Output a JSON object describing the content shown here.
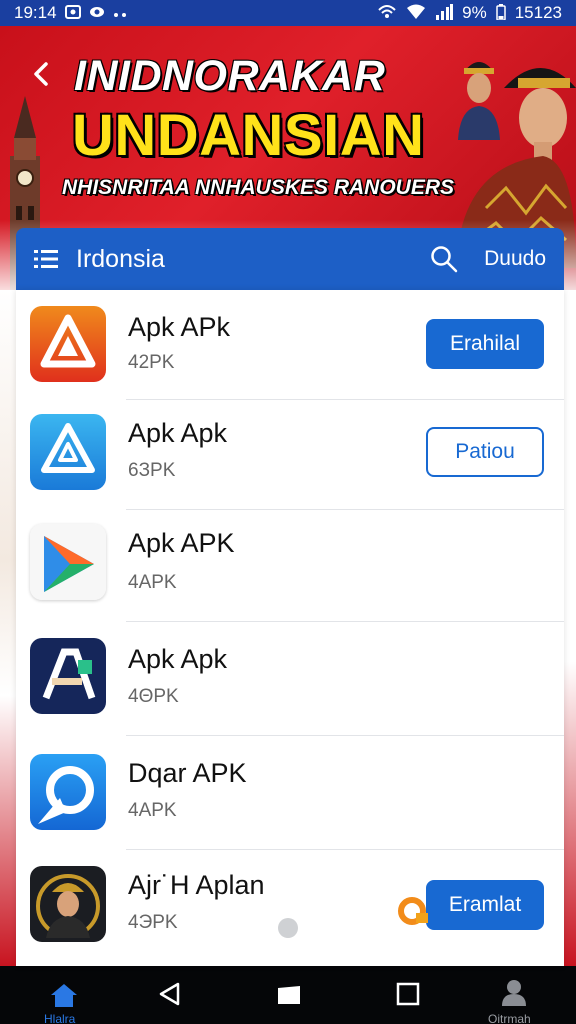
{
  "status_bar": {
    "time": "19:14",
    "battery": "9%",
    "right_time": "15123",
    "icons": [
      "photo-icon",
      "record-icon",
      "more-dots-icon",
      "hotspot-icon",
      "wifi-icon",
      "signal-icon",
      "battery-icon"
    ]
  },
  "banner": {
    "line1": "INIDNORAKAR",
    "line2": "UNDANSIAN",
    "line3": "NHISNRITAA NNHAUSKES RANOUERS"
  },
  "app_bar": {
    "title": "Irdonsia",
    "action": "Duudo"
  },
  "apps": [
    {
      "name": "Apk APk",
      "size": "42PK",
      "button": "Erahilal",
      "button_style": "solid",
      "icon": "red-apk-icon"
    },
    {
      "name": "Apk Apk",
      "size": "6ЗPK",
      "button": "Patiou",
      "button_style": "outline",
      "icon": "blue-apk-icon"
    },
    {
      "name": "Apk APK",
      "size": "4APK",
      "button": "",
      "icon": "play-triangle-icon"
    },
    {
      "name": "Apk Apk",
      "size": "4ΘPK",
      "button": "",
      "icon": "letter-a-icon"
    },
    {
      "name": "Dqar APK",
      "size": "4APK",
      "button": "",
      "icon": "circle-arrow-icon"
    },
    {
      "name": "Ajr˙H Aplan",
      "size": "4ЭPK",
      "button": "Eramlat",
      "button_style": "solid",
      "icon": "portrait-icon"
    }
  ],
  "nav": {
    "home_label": "Hlalra",
    "profile_label": "Oitrmah"
  },
  "colors": {
    "app_bar": "#1d5fc6",
    "button": "#1869d2",
    "banner_red": "#d0141e",
    "banner_yellow": "#ffe21a"
  }
}
